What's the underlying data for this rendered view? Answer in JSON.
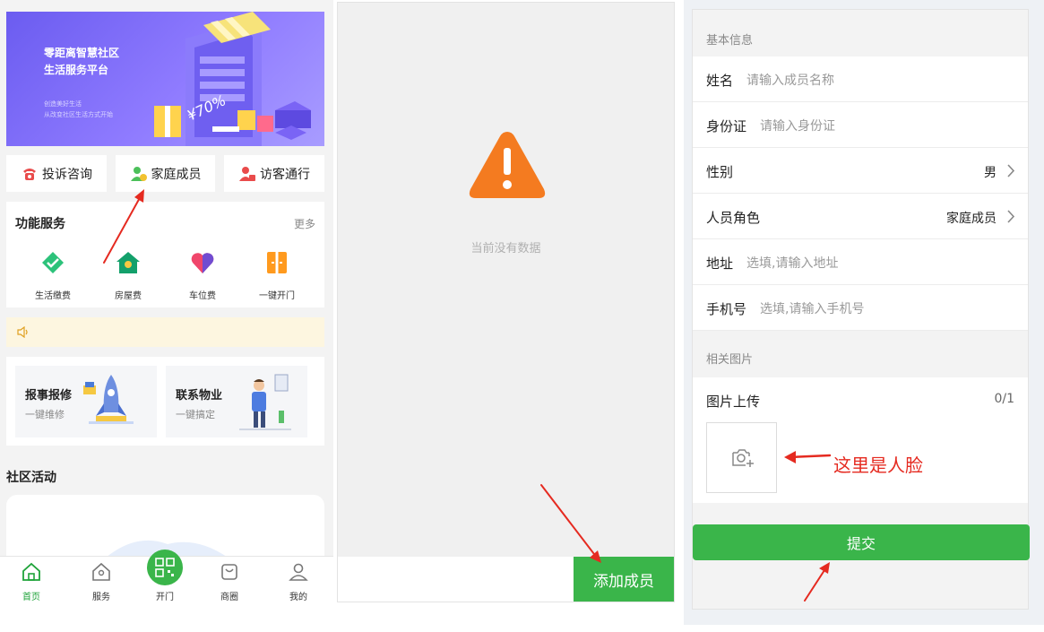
{
  "home": {
    "banner": {
      "title_line1": "零距离智慧社区",
      "title_line2": "生活服务平台",
      "sub_line1": "创造美好生活",
      "sub_line2": "从改变社区生活方式开始",
      "price_text": "¥70%"
    },
    "quick_actions": [
      {
        "label": "投诉咨询",
        "icon": "telephone-icon"
      },
      {
        "label": "家庭成员",
        "icon": "family-member-icon"
      },
      {
        "label": "访客通行",
        "icon": "visitor-icon"
      }
    ],
    "services": {
      "title": "功能服务",
      "more": "更多",
      "items": [
        {
          "label": "生活缴费",
          "icon": "payment-icon",
          "color": "#2cc27a"
        },
        {
          "label": "房屋费",
          "icon": "house-icon",
          "color": "#13a06b"
        },
        {
          "label": "车位费",
          "icon": "parking-heart-icon",
          "color": "#f0466b"
        },
        {
          "label": "一键开门",
          "icon": "door-icon",
          "color": "#ff9a1e"
        }
      ]
    },
    "notice_icon": "speaker-icon",
    "cards": [
      {
        "title": "报事报修",
        "subtitle": "一键维修",
        "icon": "rocket-illustration"
      },
      {
        "title": "联系物业",
        "subtitle": "一键搞定",
        "icon": "staff-illustration"
      }
    ],
    "activity_title": "社区活动",
    "tabbar": [
      {
        "label": "首页",
        "icon": "home-icon",
        "active": true
      },
      {
        "label": "服务",
        "icon": "service-house-icon",
        "active": false
      },
      {
        "label": "开门",
        "icon": "qr-code-icon",
        "active": false
      },
      {
        "label": "商圈",
        "icon": "shop-bag-icon",
        "active": false
      },
      {
        "label": "我的",
        "icon": "user-icon",
        "active": false
      }
    ]
  },
  "members_list": {
    "empty_text": "当前没有数据",
    "empty_icon": "warning-triangle-icon",
    "add_button": "添加成员"
  },
  "member_form": {
    "section_basic": "基本信息",
    "fields": [
      {
        "label": "姓名",
        "placeholder": "请输入成员名称"
      },
      {
        "label": "身份证",
        "placeholder": "请输入身份证"
      },
      {
        "label": "性别",
        "value": "男"
      },
      {
        "label": "人员角色",
        "value": "家庭成员"
      },
      {
        "label": "地址",
        "placeholder": "选填,请输入地址"
      },
      {
        "label": "手机号",
        "placeholder": "选填,请输入手机号"
      }
    ],
    "section_photos": "相关图片",
    "upload_label": "图片上传",
    "upload_count": "0/1",
    "upload_icon": "camera-plus-icon",
    "submit": "提交"
  },
  "annotation_note": "这里是人脸",
  "colors": {
    "primary_green": "#3ab54a",
    "annotation_red": "#e52a20",
    "warning_orange": "#f47b20",
    "banner_purple": "#7a6af5"
  }
}
